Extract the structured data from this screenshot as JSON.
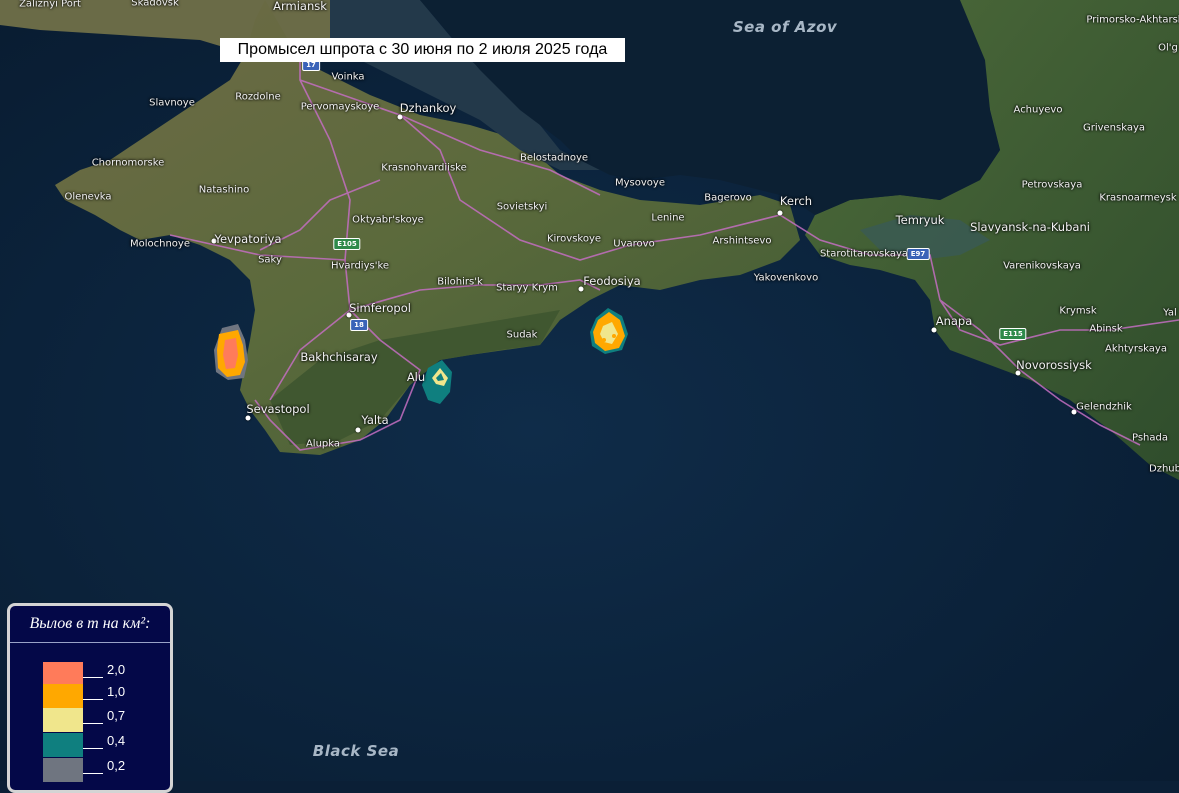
{
  "title": "Промысел шпрота с 30 июня по 2 июля 2025 года",
  "legend": {
    "title": "Вылов в т на км²:",
    "items": [
      {
        "label": "2,0",
        "color": "#ff7b5a"
      },
      {
        "label": "1,0",
        "color": "#ffa800"
      },
      {
        "label": "0,7",
        "color": "#f0e68c"
      },
      {
        "label": "0,4",
        "color": "#0f7f7f"
      },
      {
        "label": "0,2",
        "color": "#6f7580"
      }
    ]
  },
  "seas": {
    "azov": "Sea of Azov",
    "black": "Black Sea"
  },
  "places": {
    "zaliznyi_port": "Zaliznyi Port",
    "skadovsk": "Skadovsk",
    "armiansk": "Armiansk",
    "voinka": "Voinka",
    "rozdolne": "Rozdolne",
    "slavnoye": "Slavnoye",
    "pervomayskoye": "Pervomayskoye",
    "dzhankoy": "Dzhankoy",
    "chornomorske": "Chornomorske",
    "krasnohvardiiske": "Krasnohvardiiske",
    "belostadnoye": "Belostadnoye",
    "natashino": "Natashino",
    "olenevka": "Olenevka",
    "mysovoye": "Mysovoye",
    "bagerovo": "Bagerovo",
    "kerch": "Kerch",
    "sovietskyi": "Sovietskyi",
    "oktyabrskoye": "Oktyabr'skoye",
    "lenine": "Lenine",
    "molochnoye": "Molochnoye",
    "yevpatoriya": "Yevpatoriya",
    "kirovskoye": "Kirovskoye",
    "uvarovo": "Uvarovo",
    "arshintsevo": "Arshintsevo",
    "saky": "Saky",
    "hvardiiske": "Hvardiys'ke",
    "bilohirsk": "Bilohirs'k",
    "staryy_krym": "Staryy Krym",
    "feodosiya": "Feodosiya",
    "yakovenkovo": "Yakovenkovo",
    "simferopol": "Simferopol",
    "sudak": "Sudak",
    "bakhchisaray": "Bakhchisaray",
    "alushta": "Alu",
    "sevastopol": "Sevastopol",
    "yalta": "Yalta",
    "alupka": "Alupka",
    "temryuk": "Temryuk",
    "slavyansk": "Slavyansk-na-Kubani",
    "starotitarovskaya": "Starotitarovskaya",
    "varenikovskaya": "Varenikovskaya",
    "anapa": "Anapa",
    "krymsk": "Krymsk",
    "abinsk": "Abinsk",
    "akhtyrskaya": "Akhtyrskaya",
    "novorossiysk": "Novorossiysk",
    "gelendzhik": "Gelendzhik",
    "pshada": "Pshada",
    "dzhubga": "Dzhub",
    "primorsko": "Primorsko-Akhtarsk",
    "olg": "Ol'g",
    "achuyevo": "Achuyevo",
    "grivenskaya": "Grivenskaya",
    "petrovskaya": "Petrovskaya",
    "krasnoarmeyskaya": "Krasnoarmeysk",
    "yal": "Yal"
  },
  "shields": {
    "m17": "17",
    "e105": "E105",
    "m18": "18",
    "e97": "E97",
    "e115": "E115"
  }
}
